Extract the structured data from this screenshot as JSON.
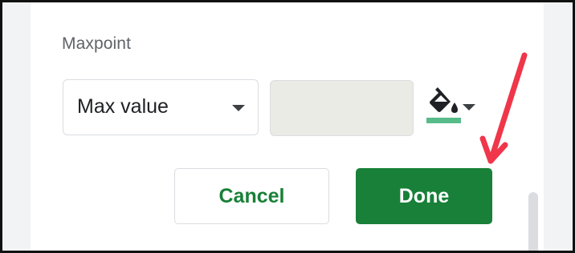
{
  "section": {
    "label": "Maxpoint"
  },
  "maxpoint": {
    "type_select": {
      "selected": "Max value",
      "icon": "dropdown-caret"
    },
    "value_input": {
      "value": "",
      "placeholder": ""
    },
    "fill_color": {
      "icon": "paint-bucket-icon",
      "swatch_color": "#57bb8a",
      "caret_icon": "dropdown-caret"
    }
  },
  "actions": {
    "cancel_label": "Cancel",
    "done_label": "Done"
  },
  "colors": {
    "accent": "#188038",
    "annotation_arrow": "#f0364a",
    "input_background": "#ebebe6"
  }
}
